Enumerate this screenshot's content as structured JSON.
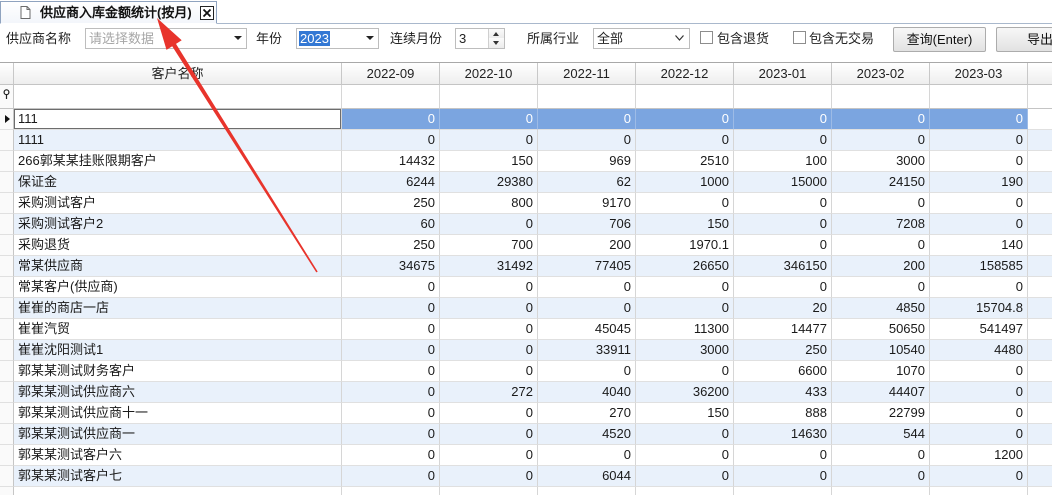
{
  "tab": {
    "title": "供应商入库金额统计(按月)"
  },
  "toolbar": {
    "supplier": {
      "label": "供应商名称",
      "placeholder": "请选择数据"
    },
    "year": {
      "label": "年份",
      "value": "2023",
      "text_selected": true
    },
    "months": {
      "label": "连续月份",
      "value": "3"
    },
    "industry": {
      "label": "所属行业",
      "value": "全部"
    },
    "include_returns": {
      "label": "包含退货",
      "checked": false
    },
    "include_no_trade": {
      "label": "包含无交易",
      "checked": false
    },
    "query_button": "查询(Enter)",
    "export_button": "导出"
  },
  "grid": {
    "name_header": "客户名称",
    "month_headers": [
      "2022-09",
      "2022-10",
      "2022-11",
      "2022-12",
      "2023-01",
      "2023-02",
      "2023-03"
    ],
    "selected_row": 0,
    "rows": [
      {
        "name": "111",
        "values": [
          "0",
          "0",
          "0",
          "0",
          "0",
          "0",
          "0"
        ]
      },
      {
        "name": "1111",
        "values": [
          "0",
          "0",
          "0",
          "0",
          "0",
          "0",
          "0"
        ]
      },
      {
        "name": "266郭某某挂账限期客户",
        "values": [
          "14432",
          "150",
          "969",
          "2510",
          "100",
          "3000",
          "0"
        ]
      },
      {
        "name": "保证金",
        "values": [
          "6244",
          "29380",
          "62",
          "1000",
          "15000",
          "24150",
          "190"
        ]
      },
      {
        "name": "采购测试客户",
        "values": [
          "250",
          "800",
          "9170",
          "0",
          "0",
          "0",
          "0"
        ]
      },
      {
        "name": "采购测试客户2",
        "values": [
          "60",
          "0",
          "706",
          "150",
          "0",
          "7208",
          "0"
        ]
      },
      {
        "name": "采购退货",
        "values": [
          "250",
          "700",
          "200",
          "1970.1",
          "0",
          "0",
          "140"
        ]
      },
      {
        "name": "常某供应商",
        "values": [
          "34675",
          "31492",
          "77405",
          "26650",
          "346150",
          "200",
          "158585"
        ]
      },
      {
        "name": "常某客户(供应商)",
        "values": [
          "0",
          "0",
          "0",
          "0",
          "0",
          "0",
          "0"
        ]
      },
      {
        "name": "崔崔的商店一店",
        "values": [
          "0",
          "0",
          "0",
          "0",
          "20",
          "4850",
          "15704.8"
        ]
      },
      {
        "name": "崔崔汽贸",
        "values": [
          "0",
          "0",
          "45045",
          "11300",
          "14477",
          "50650",
          "541497"
        ]
      },
      {
        "name": "崔崔沈阳测试1",
        "values": [
          "0",
          "0",
          "33911",
          "3000",
          "250",
          "10540",
          "4480"
        ]
      },
      {
        "name": "郭某某测试财务客户",
        "values": [
          "0",
          "0",
          "0",
          "0",
          "6600",
          "1070",
          "0"
        ]
      },
      {
        "name": "郭某某测试供应商六",
        "values": [
          "0",
          "272",
          "4040",
          "36200",
          "433",
          "44407",
          "0"
        ]
      },
      {
        "name": "郭某某测试供应商十一",
        "values": [
          "0",
          "0",
          "270",
          "150",
          "888",
          "22799",
          "0"
        ]
      },
      {
        "name": "郭某某测试供应商一",
        "values": [
          "0",
          "0",
          "4520",
          "0",
          "14630",
          "544",
          "0"
        ]
      },
      {
        "name": "郭某某测试客户六",
        "values": [
          "0",
          "0",
          "0",
          "0",
          "0",
          "0",
          "1200"
        ]
      },
      {
        "name": "郭某某测试客户七",
        "values": [
          "0",
          "0",
          "6044",
          "0",
          "0",
          "0",
          "0"
        ]
      }
    ]
  },
  "icons": {
    "tab": "page-icon",
    "tab_close": "close-icon",
    "dropdown": "chevron-down-icon",
    "spin_up": "arrow-up-icon",
    "spin_down": "arrow-down-icon",
    "filter_row": "filter-icon",
    "current_row": "current-row-arrow-icon",
    "annotation": "red-arrow"
  },
  "colors": {
    "selected_cells": "#7ba5e0",
    "alternate_row": "#e9f1fb",
    "text_selection": "#3378d4",
    "annotation_arrow": "#e8342c"
  }
}
